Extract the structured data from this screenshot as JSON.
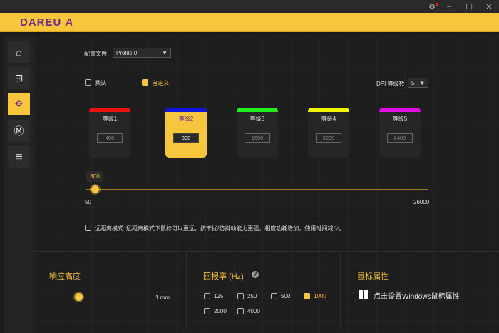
{
  "window": {
    "settings_icon": "gear-icon",
    "minimize": "–",
    "maximize": "☐",
    "close": "✕"
  },
  "brand": {
    "logo": "DAREU",
    "logo_mark": "A"
  },
  "sidebar": {
    "items": [
      {
        "icon": "home-icon",
        "glyph": "⌂"
      },
      {
        "icon": "plus-box-icon",
        "glyph": "⊞"
      },
      {
        "icon": "dpi-move-icon",
        "glyph": "✥"
      },
      {
        "icon": "macro-m-icon",
        "glyph": "Ⓜ"
      },
      {
        "icon": "list-icon",
        "glyph": "≣"
      }
    ],
    "active": 2
  },
  "profile": {
    "label": "配置文件",
    "value": "Profile 0"
  },
  "mode": {
    "default_label": "默认",
    "custom_label": "自定义",
    "custom_checked": true
  },
  "dpi_count": {
    "label": "DPI 等级数",
    "value": "5"
  },
  "levels": [
    {
      "name": "等级1",
      "value": "400",
      "color": "#ee1111"
    },
    {
      "name": "等级2",
      "value": "800",
      "color": "#1111dd"
    },
    {
      "name": "等级3",
      "value": "1600",
      "color": "#22ee22"
    },
    {
      "name": "等级4",
      "value": "3200",
      "color": "#f5f500"
    },
    {
      "name": "等级5",
      "value": "6400",
      "color": "#e011e0"
    }
  ],
  "active_level": 1,
  "dpi_slider": {
    "value": "800",
    "min": "50",
    "max": "26000"
  },
  "long_distance": {
    "label": "远距离模式:",
    "desc": "远距离模式下鼠标可以更远，抗干扰/防抖动能力更强，相应功耗增加，使用时间减少。",
    "checked": false
  },
  "lod": {
    "title": "响应高度",
    "value": "1 mm"
  },
  "polling": {
    "title": "回报率 (Hz)",
    "help": "?",
    "options": [
      "125",
      "250",
      "500",
      "1000",
      "2000",
      "4000"
    ],
    "selected": "1000"
  },
  "mouse_props": {
    "title": "鼠标属性",
    "link": "点击设置Windows鼠标属性"
  }
}
